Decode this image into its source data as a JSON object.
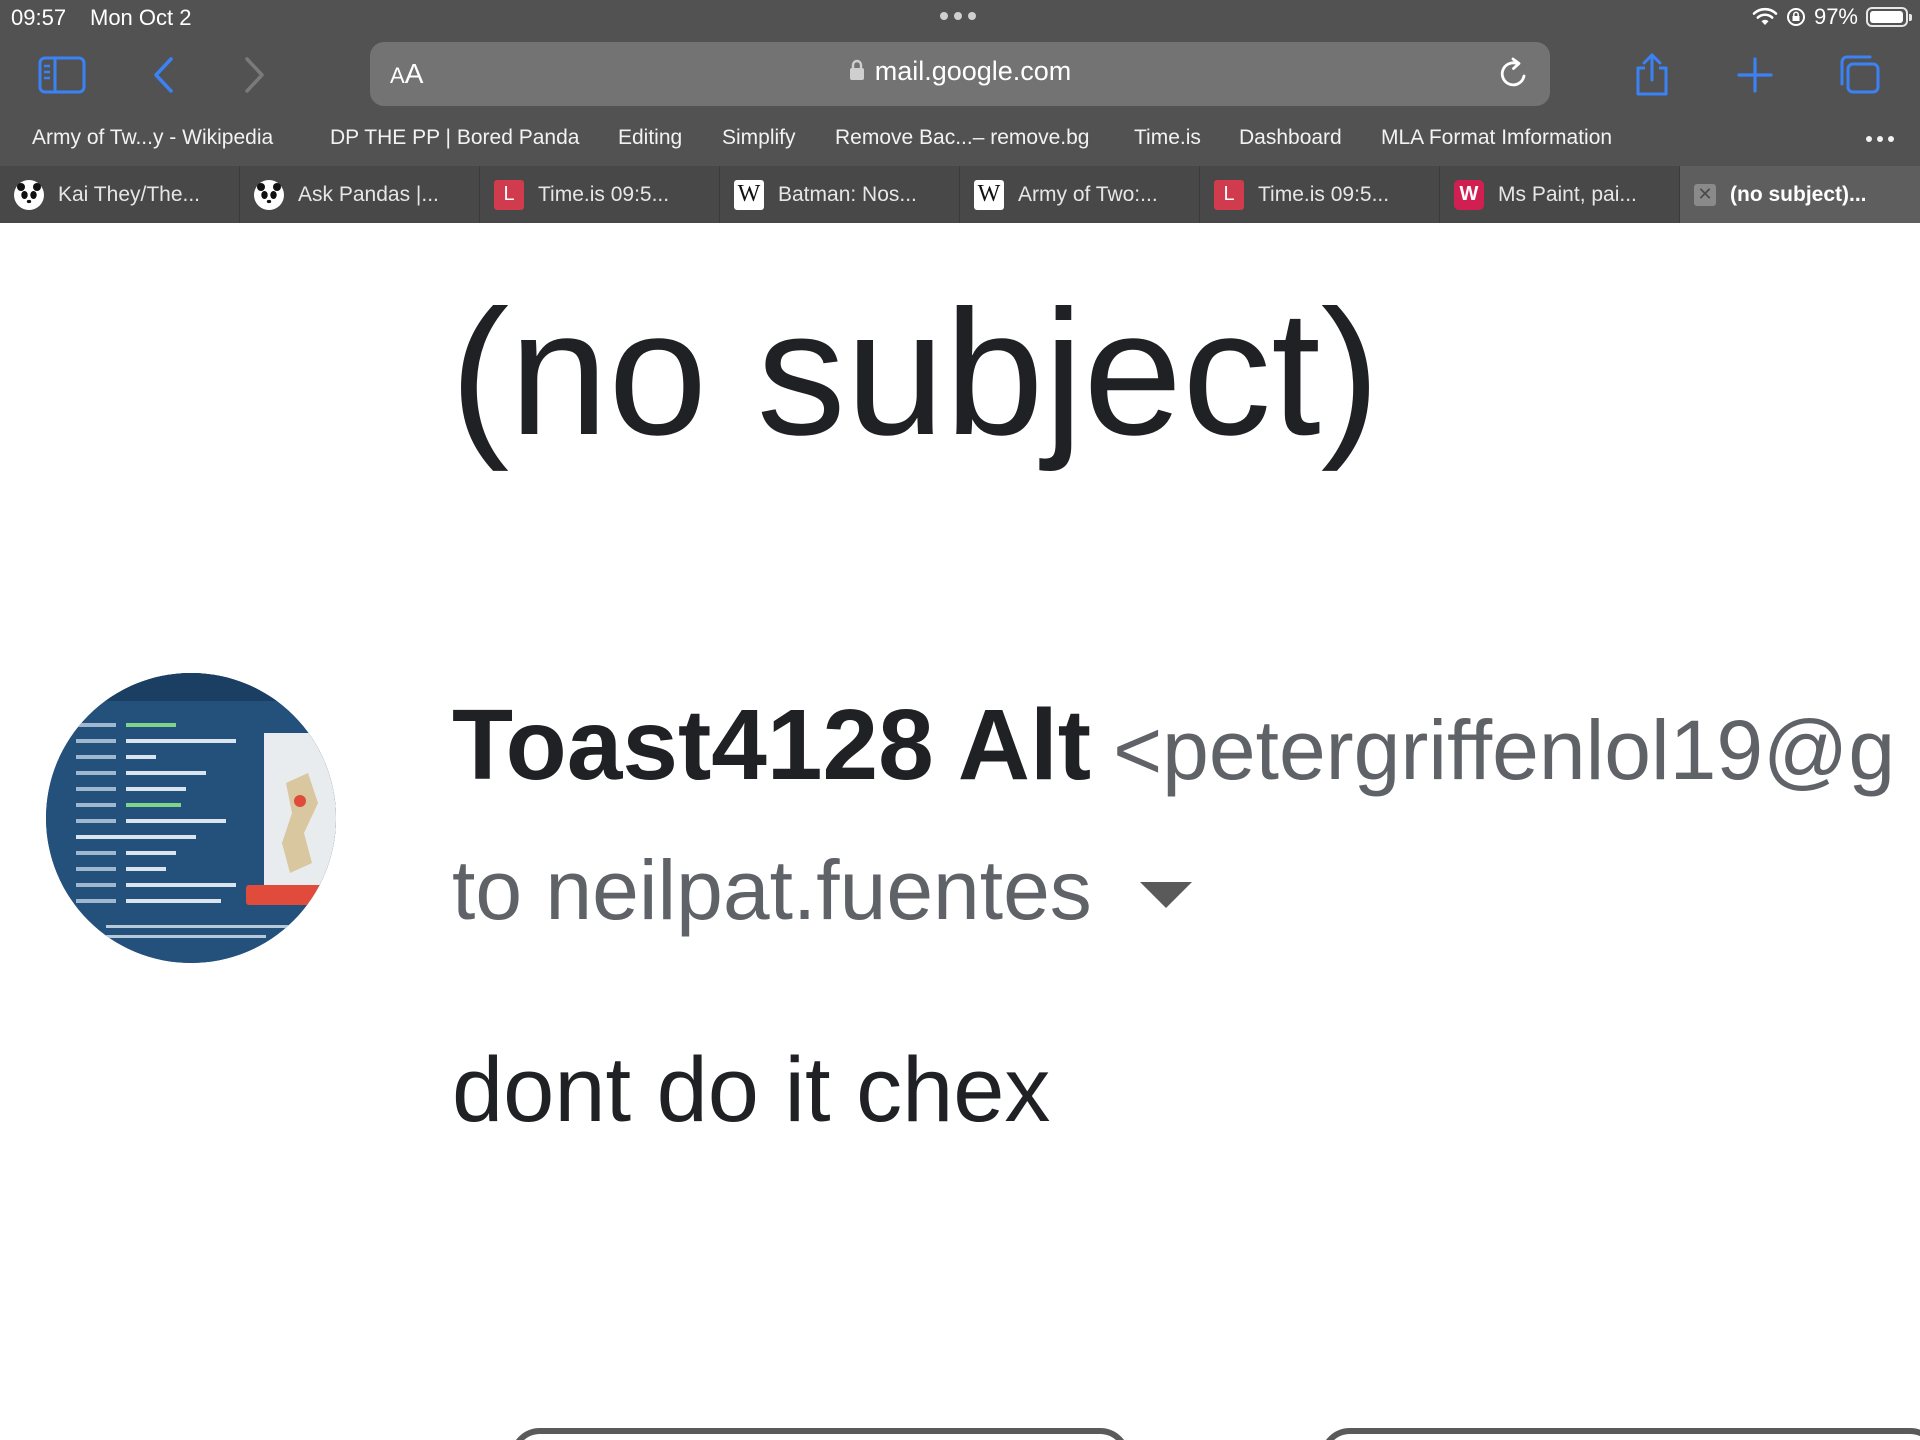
{
  "status_bar": {
    "time": "09:57",
    "date": "Mon Oct 2",
    "battery": "97%",
    "battery_level": 0.97
  },
  "address_bar": {
    "reader_label_small": "A",
    "reader_label_large": "A",
    "url": "mail.google.com"
  },
  "bookmarks": [
    "Army of Tw...y - Wikipedia",
    "DP THE PP | Bored Panda",
    "Editing",
    "Simplify",
    "Remove Bac...– remove.bg",
    "Time.is",
    "Dashboard",
    "MLA Format Imformation"
  ],
  "tabs": [
    {
      "title": "Kai They/The...",
      "icon": "panda-icon"
    },
    {
      "title": "Ask Pandas |...",
      "icon": "panda-icon"
    },
    {
      "title": "Time.is 09:5...",
      "icon": "time-is-icon",
      "glyph": "L"
    },
    {
      "title": "Batman: Nos...",
      "icon": "wikipedia-icon",
      "glyph": "W"
    },
    {
      "title": "Army of Two:...",
      "icon": "wikipedia-icon",
      "glyph": "W"
    },
    {
      "title": "Time.is 09:5...",
      "icon": "time-is-icon",
      "glyph": "L"
    },
    {
      "title": "Ms Paint, pai...",
      "icon": "paint-icon",
      "glyph": "W"
    },
    {
      "title": "(no subject)...",
      "icon": "close-icon",
      "glyph": "✕"
    }
  ],
  "email": {
    "subject": "(no subject)",
    "sender_name": "Toast4128 Alt",
    "sender_email": "<petergriffenlol19@g",
    "recipient": "to neilpat.fuentes",
    "body": "dont do it chex"
  },
  "colors": {
    "chrome_bg": "#525252",
    "accent_blue": "#3b82f6",
    "text_dark": "#202124",
    "text_gray": "#5f6368"
  }
}
